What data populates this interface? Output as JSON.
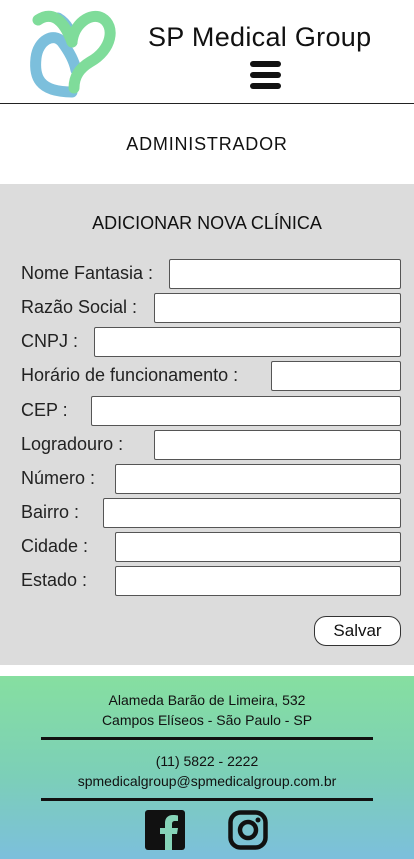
{
  "header": {
    "brand": "SP Medical Group",
    "logo_icon": "heart-logo-icon",
    "menu_icon": "hamburger-menu-icon"
  },
  "section": {
    "title": "ADMINISTRADOR"
  },
  "form": {
    "title": "ADICIONAR NOVA CLÍNICA",
    "fields": [
      {
        "label": "Nome Fantasia :",
        "value": ""
      },
      {
        "label": "Razão Social :",
        "value": ""
      },
      {
        "label": "CNPJ :",
        "value": ""
      },
      {
        "label": "Horário de funcionamento :",
        "value": ""
      },
      {
        "label": "CEP :",
        "value": ""
      },
      {
        "label": "Logradouro :",
        "value": ""
      },
      {
        "label": "Número :",
        "value": ""
      },
      {
        "label": "Bairro :",
        "value": ""
      },
      {
        "label": "Cidade :",
        "value": ""
      },
      {
        "label": "Estado :",
        "value": ""
      }
    ],
    "save_label": "Salvar"
  },
  "footer": {
    "address_line1": "Alameda Barão de Limeira, 532",
    "address_line2": "Campos Elíseos - São Paulo - SP",
    "phone": "(11) 5822 - 2222",
    "email": "spmedicalgroup@spmedicalgroup.com.br",
    "social": [
      "facebook-icon",
      "instagram-icon"
    ]
  },
  "colors": {
    "logo_green": "#7fdc9a",
    "logo_blue": "#7cbfdc",
    "panel_bg": "#dcdcdc",
    "footer_top": "#86dfa0",
    "footer_bottom": "#7cbfdc"
  }
}
